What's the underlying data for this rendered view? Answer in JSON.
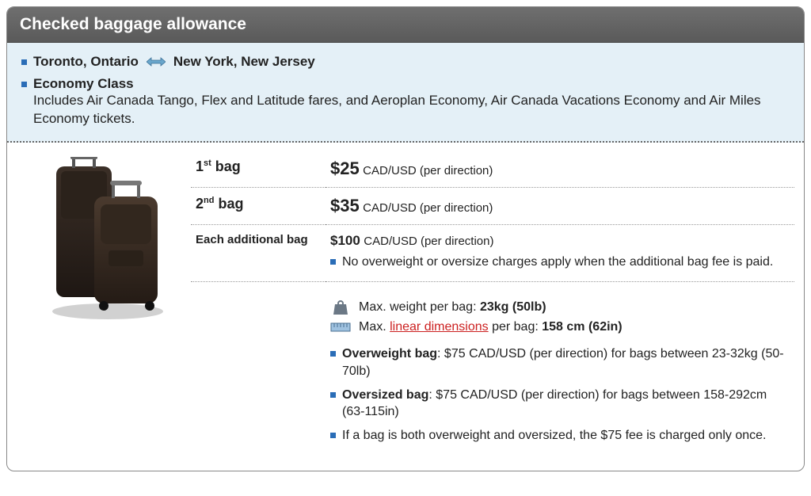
{
  "header": {
    "title": "Checked baggage allowance"
  },
  "route": {
    "origin": "Toronto, Ontario",
    "destination": "New York, New Jersey"
  },
  "fare": {
    "class_title": "Economy Class",
    "class_desc": "Includes Air Canada Tango, Flex and Latitude fares, and Aeroplan Economy, Air Canada Vacations Economy and Air Miles Economy tickets."
  },
  "bags": {
    "first": {
      "label_num": "1",
      "label_ord": "st",
      "label_suffix": " bag",
      "price": "$25",
      "unit": "CAD/USD (per direction)"
    },
    "second": {
      "label_num": "2",
      "label_ord": "nd",
      "label_suffix": " bag",
      "price": "$35",
      "unit": "CAD/USD (per direction)"
    },
    "additional": {
      "label": "Each additional bag",
      "price": "$100",
      "unit": "CAD/USD (per direction)",
      "note": "No overweight or oversize charges apply when the additional bag fee is paid."
    }
  },
  "limits": {
    "weight_prefix": "Max. weight per bag: ",
    "weight_value": "23kg (50lb)",
    "dim_prefix": "Max. ",
    "dim_link": "linear dimensions",
    "dim_mid": " per bag: ",
    "dim_value": "158 cm (62in)"
  },
  "extras": {
    "overweight_label": "Overweight bag",
    "overweight_text": ": $75 CAD/USD (per direction) for bags between 23-32kg (50-70lb)",
    "oversized_label": "Oversized bag",
    "oversized_text": ": $75 CAD/USD (per direction) for bags between 158-292cm (63-115in)",
    "combined_text": "If a bag is both overweight and oversized, the $75 fee is charged only once."
  }
}
